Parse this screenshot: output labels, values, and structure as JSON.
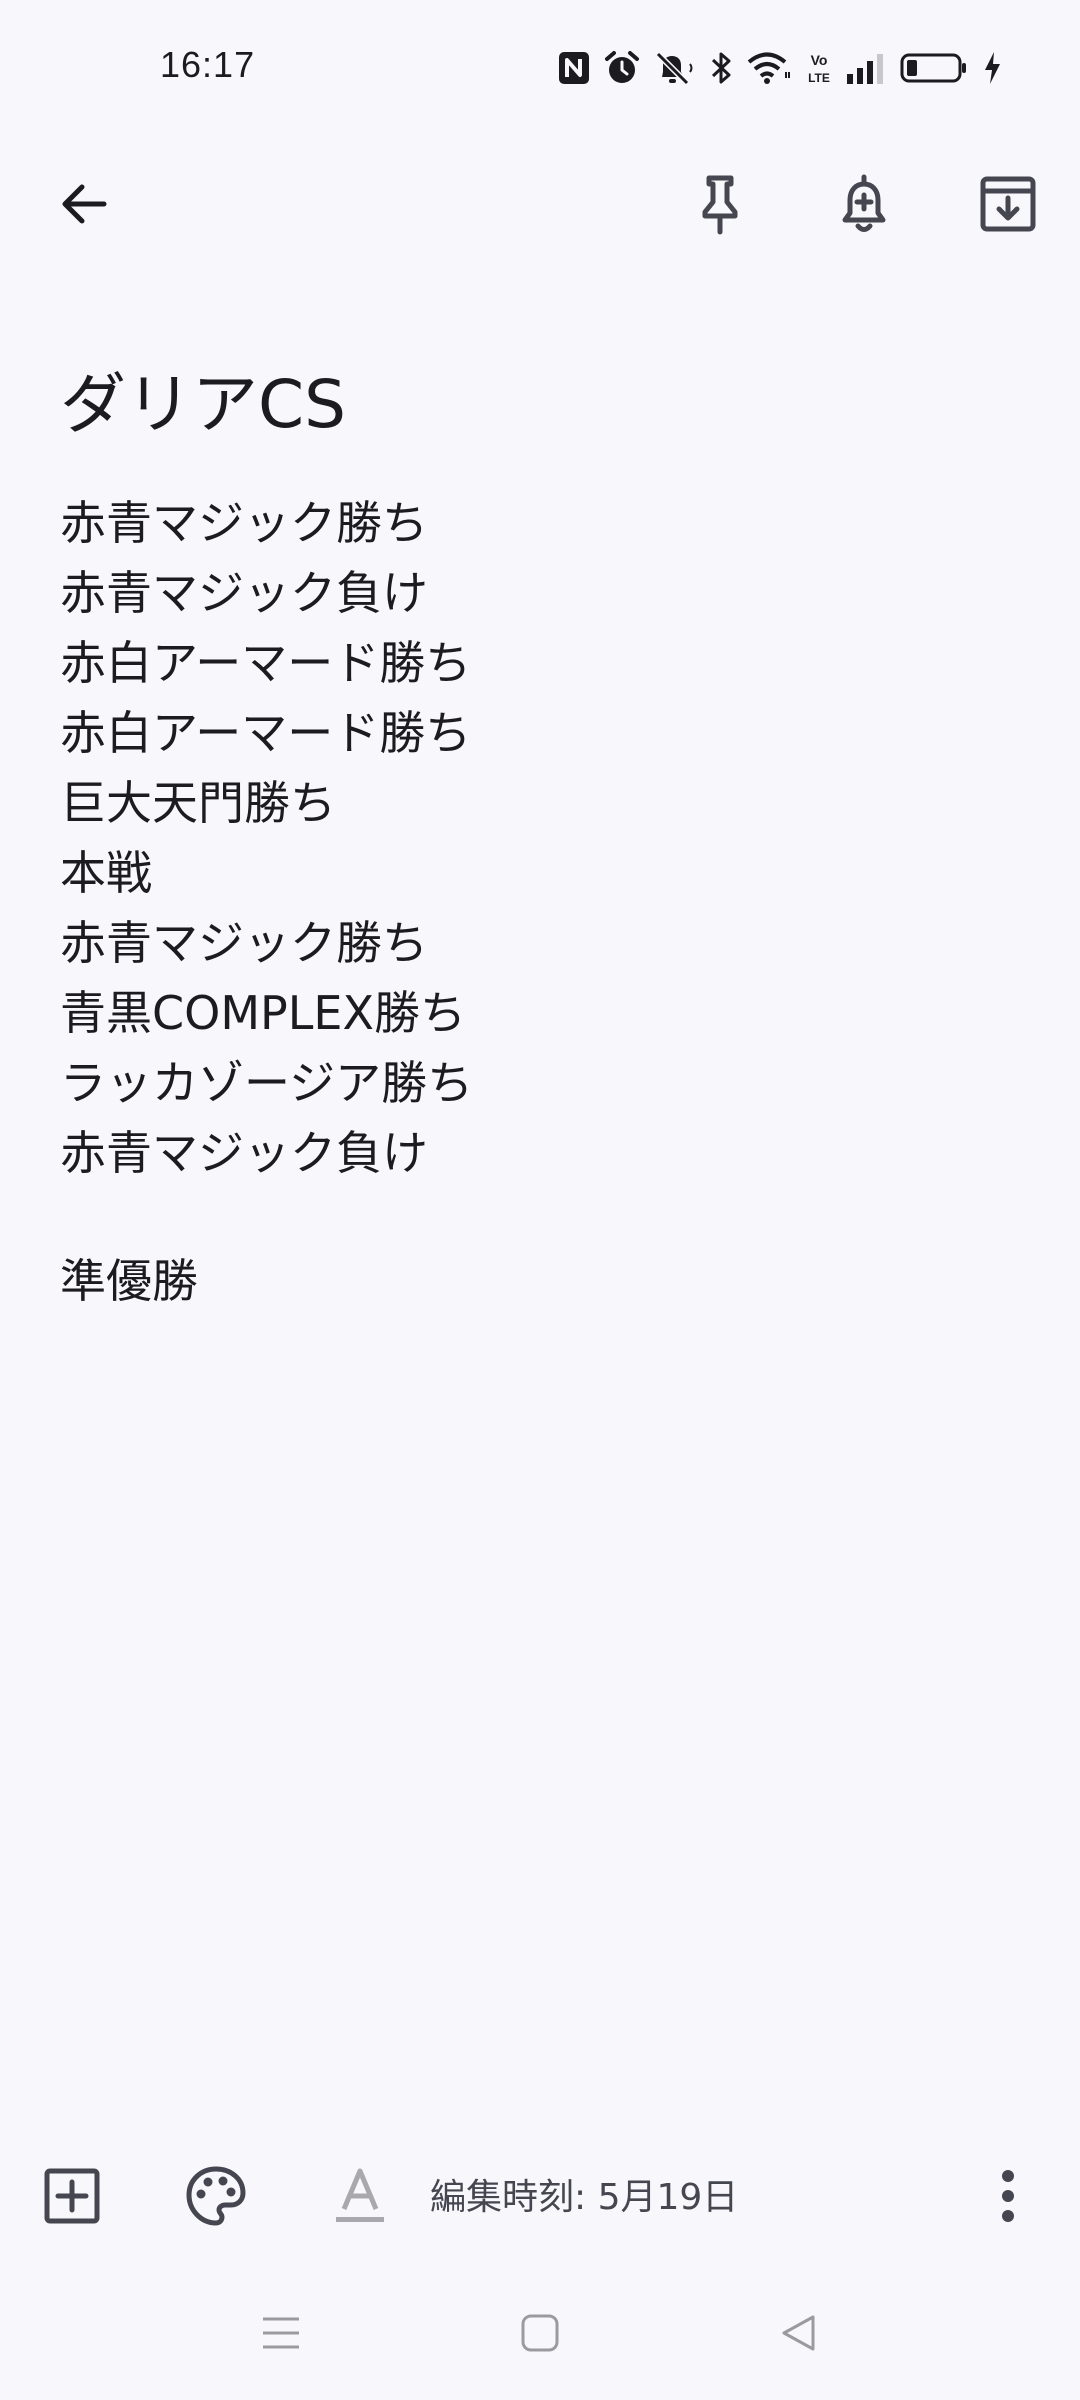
{
  "status_bar": {
    "time": "16:17",
    "icons": [
      "nfc-icon",
      "alarm-icon",
      "mute-icon",
      "bluetooth-icon",
      "wifi-icon",
      "volte-icon",
      "signal-icon",
      "battery-icon",
      "charging-icon"
    ],
    "volte_label_top": "Vo",
    "volte_label_bottom": "LTE"
  },
  "top_bar": {
    "icons": [
      "back-arrow-icon",
      "pin-icon",
      "reminder-bell-icon",
      "archive-icon"
    ]
  },
  "note": {
    "title": "ダリアCS",
    "lines": [
      "赤青マジック勝ち",
      "赤青マジック負け",
      "赤白アーマード勝ち",
      "赤白アーマード勝ち",
      "巨大天門勝ち",
      "本戦",
      "赤青マジック勝ち",
      "青黒COMPLEX勝ち",
      "ラッカゾージア勝ち",
      "赤青マジック負け"
    ],
    "footer_line": "準優勝"
  },
  "bottom_bar": {
    "icons": [
      "add-box-icon",
      "palette-icon",
      "text-format-icon",
      "more-vert-icon"
    ],
    "edited_label": "編集時刻: 5月19日"
  },
  "nav_bar": {
    "icons": [
      "menu-lines-icon",
      "home-square-icon",
      "back-triangle-icon"
    ]
  },
  "colors": {
    "background": "#f8f8fc",
    "text": "#1c1b1f",
    "icon": "#45464f",
    "nav_icon": "#9a9aa0"
  }
}
